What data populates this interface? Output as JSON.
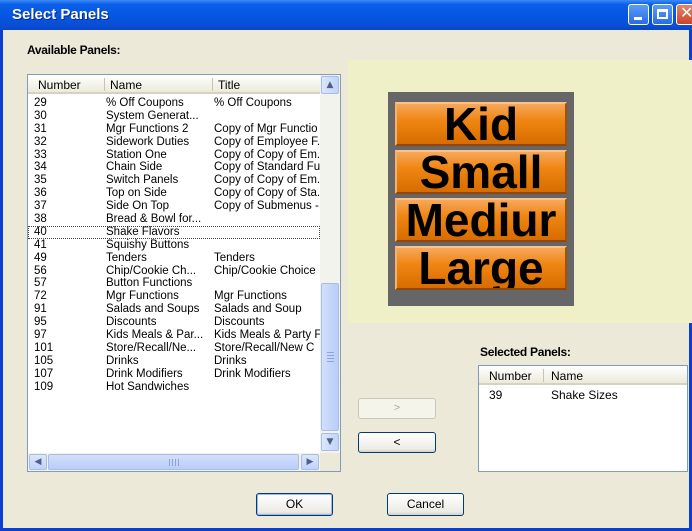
{
  "window": {
    "title": "Select Panels"
  },
  "titlebar_buttons": {
    "minimize_icon": "minimize-icon",
    "maximize_icon": "maximize-icon",
    "close_icon": "close-icon",
    "close_glyph": "✕"
  },
  "available": {
    "label": "Available Panels:",
    "columns": {
      "number": "Number",
      "name": "Name",
      "title": "Title"
    },
    "rows": [
      {
        "number": "29",
        "name": "% Off Coupons",
        "title": "% Off Coupons"
      },
      {
        "number": "30",
        "name": "System Generat...",
        "title": ""
      },
      {
        "number": "31",
        "name": "Mgr Functions 2",
        "title": "Copy of Mgr Functio"
      },
      {
        "number": "32",
        "name": "Sidework Duties",
        "title": "Copy of Employee F."
      },
      {
        "number": "33",
        "name": "Station One",
        "title": "Copy of Copy of Em."
      },
      {
        "number": "34",
        "name": "Chain Side",
        "title": "Copy of Standard Fu"
      },
      {
        "number": "35",
        "name": "Switch Panels",
        "title": "Copy of Copy of Em."
      },
      {
        "number": "36",
        "name": "Top on Side",
        "title": "Copy of Copy of Sta."
      },
      {
        "number": "37",
        "name": "Side On Top",
        "title": "Copy of Submenus -"
      },
      {
        "number": "38",
        "name": "Bread & Bowl for...",
        "title": ""
      },
      {
        "number": "40",
        "name": "Shake Flavors",
        "title": ""
      },
      {
        "number": "41",
        "name": "Squishy Buttons",
        "title": ""
      },
      {
        "number": "49",
        "name": "Tenders",
        "title": "Tenders"
      },
      {
        "number": "56",
        "name": "Chip/Cookie Ch...",
        "title": "Chip/Cookie Choice"
      },
      {
        "number": "57",
        "name": "Button Functions",
        "title": ""
      },
      {
        "number": "72",
        "name": "Mgr Functions",
        "title": "Mgr Functions"
      },
      {
        "number": "91",
        "name": "Salads and Soups",
        "title": "Salads and Soup"
      },
      {
        "number": "95",
        "name": "Discounts",
        "title": "Discounts"
      },
      {
        "number": "97",
        "name": "Kids Meals & Par...",
        "title": "Kids Meals & Party F"
      },
      {
        "number": "101",
        "name": "Store/Recall/Ne...",
        "title": "Store/Recall/New C"
      },
      {
        "number": "105",
        "name": "Drinks",
        "title": "Drinks"
      },
      {
        "number": "107",
        "name": "Drink Modifiers",
        "title": "Drink Modifiers"
      },
      {
        "number": "109",
        "name": "Hot Sandwiches",
        "title": ""
      }
    ],
    "focused_row": "40",
    "scroll_glyphs": {
      "up": "▲",
      "down": "▼",
      "left": "◀",
      "right": "▶"
    }
  },
  "preview": {
    "buttons": [
      {
        "label": "Kid"
      },
      {
        "label": "Small"
      },
      {
        "label": "Mediur"
      },
      {
        "label": "Large"
      }
    ],
    "colors": {
      "panel_bg": "#666669",
      "button": "#f08612",
      "area_bg": "#efefc8"
    }
  },
  "selected": {
    "label": "Selected Panels:",
    "columns": {
      "number": "Number",
      "name": "Name"
    },
    "rows": [
      {
        "number": "39",
        "name": "Shake Sizes"
      }
    ]
  },
  "actions": {
    "add": ">",
    "remove": "<",
    "ok": "OK",
    "cancel": "Cancel"
  }
}
